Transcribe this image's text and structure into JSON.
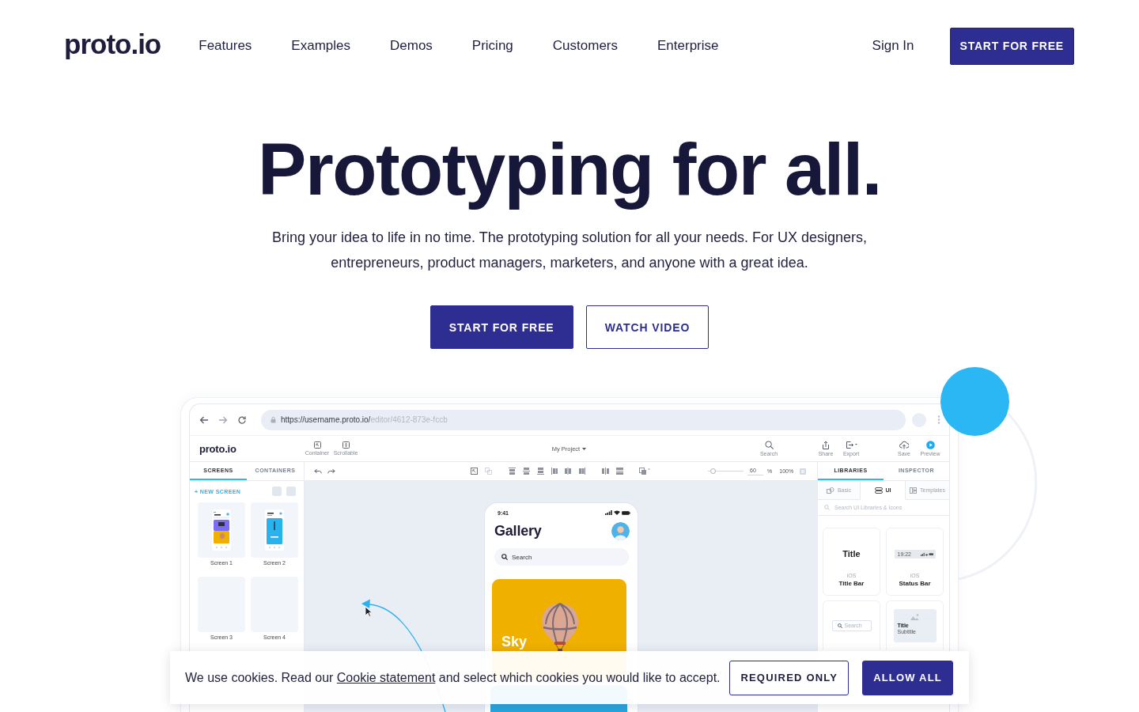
{
  "header": {
    "logo": "proto.io",
    "nav": [
      {
        "label": "Features"
      },
      {
        "label": "Examples"
      },
      {
        "label": "Demos"
      },
      {
        "label": "Pricing"
      },
      {
        "label": "Customers"
      },
      {
        "label": "Enterprise"
      }
    ],
    "sign_in": "Sign In",
    "cta": "START FOR FREE"
  },
  "hero": {
    "title": "Prototyping for all.",
    "subtitle": "Bring your idea to life in no time. The prototyping solution for all your needs. For UX designers, entrepreneurs, product managers, marketers, and anyone with a great idea.",
    "buttons": [
      {
        "label": "START FOR FREE",
        "kind": "primary"
      },
      {
        "label": "WATCH VIDEO",
        "kind": "outline"
      }
    ]
  },
  "browser": {
    "url_host": "https://username.proto.io/",
    "url_path": "editor/4612-873e-fccb"
  },
  "editor": {
    "logo": "proto.io",
    "insert_tools": [
      {
        "kind": "container",
        "label": "Container"
      },
      {
        "kind": "scrollable",
        "label": "Scrollable"
      }
    ],
    "project": "My Project",
    "actions": [
      {
        "kind": "search",
        "label": "Search"
      },
      {
        "kind": "share",
        "label": "Share"
      },
      {
        "kind": "export",
        "label": "Export"
      },
      {
        "kind": "save",
        "label": "Save"
      },
      {
        "kind": "preview",
        "label": "Preview"
      }
    ],
    "left_tabs": [
      {
        "label": "SCREENS",
        "selected": true
      },
      {
        "label": "CONTAINERS",
        "selected": false
      }
    ],
    "new_screen": "+ NEW SCREEN",
    "screens": [
      {
        "label": "Screen 1",
        "kind": "gallery"
      },
      {
        "label": "Screen 2",
        "kind": "album"
      },
      {
        "label": "Screen 3",
        "kind": "blank"
      },
      {
        "label": "Screen 4",
        "kind": "blank"
      }
    ],
    "zoom": {
      "level": 0.15,
      "value": "60",
      "unit": "%",
      "preset": "100%"
    },
    "right_tabs": [
      {
        "label": "LIBRARIES",
        "selected": true
      },
      {
        "label": "INSPECTOR",
        "selected": false
      }
    ],
    "library": {
      "tabs": [
        {
          "kind": "basic",
          "label": "Basic",
          "selected": false
        },
        {
          "kind": "ui",
          "label": "UI",
          "selected": true
        },
        {
          "kind": "templates",
          "label": "Templates",
          "selected": false
        }
      ],
      "search": {
        "placeholder": "Search UI Libraries & Icons"
      },
      "items": [
        {
          "kind": "title_bar",
          "preview": "Title",
          "platform": "iOS",
          "name": "Title Bar"
        },
        {
          "kind": "status_bar",
          "preview": "19:22",
          "platform": "iOS",
          "name": "Status Bar"
        },
        {
          "kind": "search_bar",
          "preview": "Search"
        },
        {
          "kind": "card",
          "preview": "Title",
          "preview_subtitle": "Subtitle"
        }
      ]
    },
    "phone": {
      "time": "9:41",
      "title": "Gallery",
      "search": {
        "placeholder": "Search"
      },
      "albums": [
        {
          "name": "Sky",
          "color": "#f0b000"
        },
        {
          "color": "#2aa5dc"
        }
      ]
    }
  },
  "cookie_banner": {
    "text_before": "We use cookies. Read our",
    "link": "Cookie statement",
    "text_after": "and select which cookies you would like to accept.",
    "buttons": [
      {
        "label": "REQUIRED ONLY",
        "kind": "outline"
      },
      {
        "label": "ALLOW ALL",
        "kind": "primary"
      }
    ]
  }
}
